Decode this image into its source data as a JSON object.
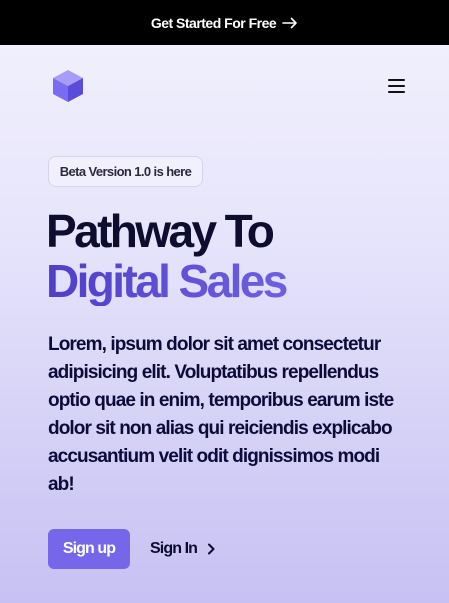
{
  "topbar": {
    "cta_label": "Get Started For Free",
    "arrow_icon": "arrow-right-icon"
  },
  "nav": {
    "logo_icon": "cube-logo-icon",
    "menu_icon": "hamburger-menu-icon"
  },
  "hero": {
    "badge": "Beta Version 1.0 is here",
    "headline_line1": "Pathway To",
    "headline_line2": "Digital Sales",
    "description": "Lorem, ipsum dolor sit amet consectetur adipisicing elit. Voluptatibus repellendus optio quae in enim, temporibus earum iste dolor sit non alias qui reiciendis explicabo accusantium velit odit dignissimos modi ab!",
    "signup_label": "Sign up",
    "signin_label": "Sign In",
    "signin_icon": "chevron-right-icon"
  },
  "colors": {
    "accent": "#7566ea",
    "heading_dark": "#0e0c2f",
    "heading_purple": "#5a49d3",
    "topbar_bg": "#000000"
  }
}
